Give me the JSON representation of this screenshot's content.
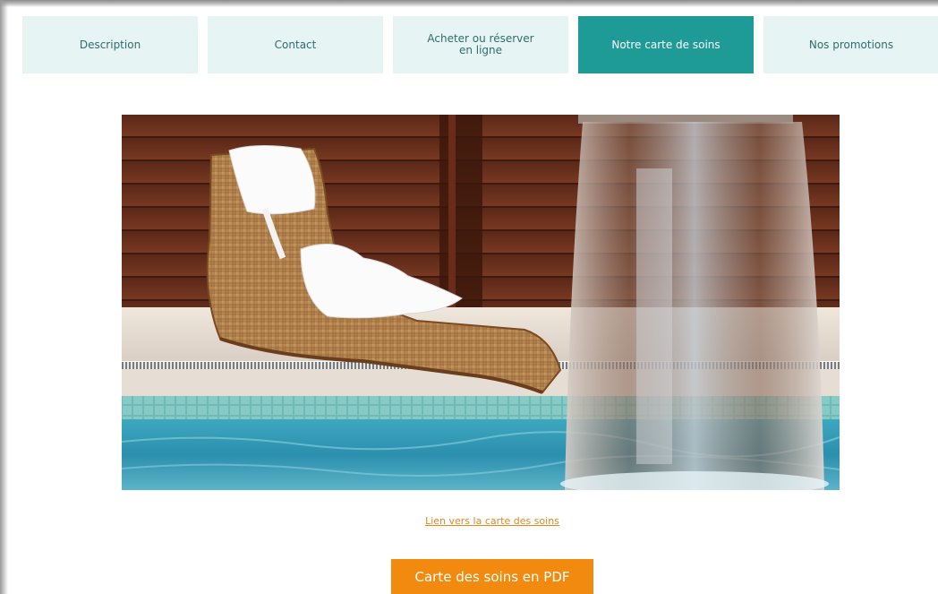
{
  "tabs": [
    {
      "label": "Description",
      "active": false
    },
    {
      "label": "Contact",
      "active": false
    },
    {
      "label": "Acheter ou réserver\nen ligne",
      "label_line1": "Acheter ou réserver",
      "label_line2": "en ligne",
      "active": false
    },
    {
      "label": "Notre carte de soins",
      "active": true
    },
    {
      "label": "Nos promotions",
      "active": false
    }
  ],
  "main": {
    "link_text": "Lien vers la carte des soins",
    "pdf_button_label": "Carte des soins en PDF"
  },
  "colors": {
    "tab_bg": "#e6f5f4",
    "tab_active_bg": "#1e9b97",
    "accent_orange": "#f28a0f",
    "link_orange": "#e8861a"
  }
}
